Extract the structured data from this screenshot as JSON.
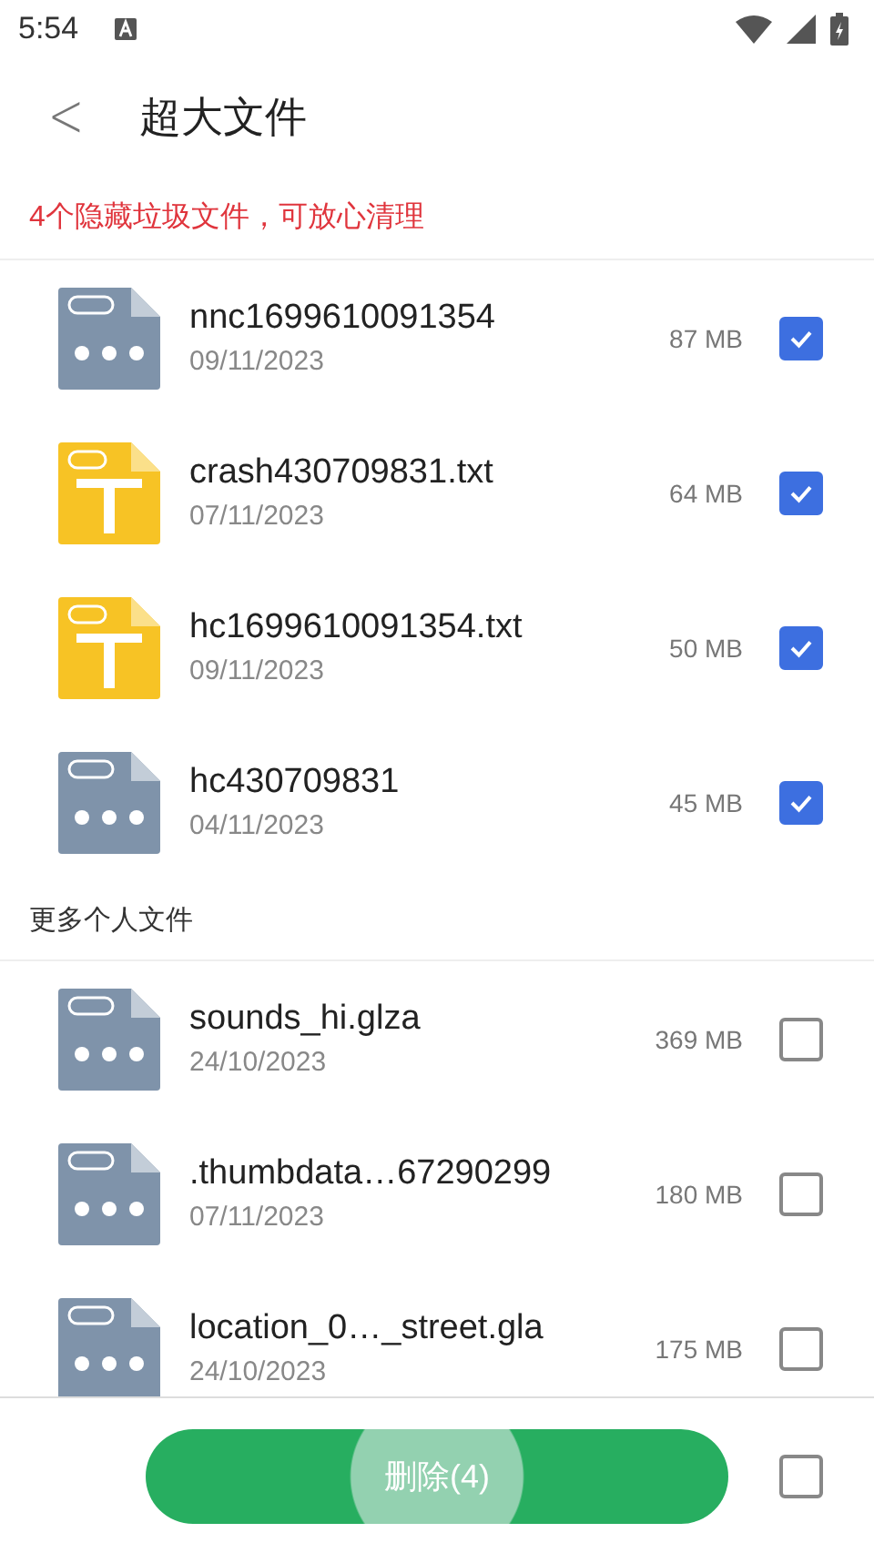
{
  "status_bar": {
    "time": "5:54"
  },
  "header": {
    "back": "<",
    "title": "超大文件"
  },
  "notice": "4个隐藏垃圾文件，可放心清理",
  "sections": [
    {
      "files": [
        {
          "name": "nnc1699610091354",
          "date": "09/11/2023",
          "size": "87 MB",
          "kind": "other",
          "checked": true
        },
        {
          "name": "crash430709831.txt",
          "date": "07/11/2023",
          "size": "64 MB",
          "kind": "txt",
          "checked": true
        },
        {
          "name": "hc1699610091354.txt",
          "date": "09/11/2023",
          "size": "50 MB",
          "kind": "txt",
          "checked": true
        },
        {
          "name": "hc430709831",
          "date": "04/11/2023",
          "size": "45 MB",
          "kind": "other",
          "checked": true
        }
      ]
    },
    {
      "title": "更多个人文件",
      "files": [
        {
          "name": "sounds_hi.glza",
          "date": "24/10/2023",
          "size": "369 MB",
          "kind": "other",
          "checked": false
        },
        {
          "name": ".thumbdata…67290299",
          "date": "07/11/2023",
          "size": "180 MB",
          "kind": "other",
          "checked": false
        },
        {
          "name": "location_0…_street.gla",
          "date": "24/10/2023",
          "size": "175 MB",
          "kind": "other",
          "checked": false
        }
      ]
    }
  ],
  "bottom": {
    "button": "删除(4)",
    "select_all_checked": false
  }
}
